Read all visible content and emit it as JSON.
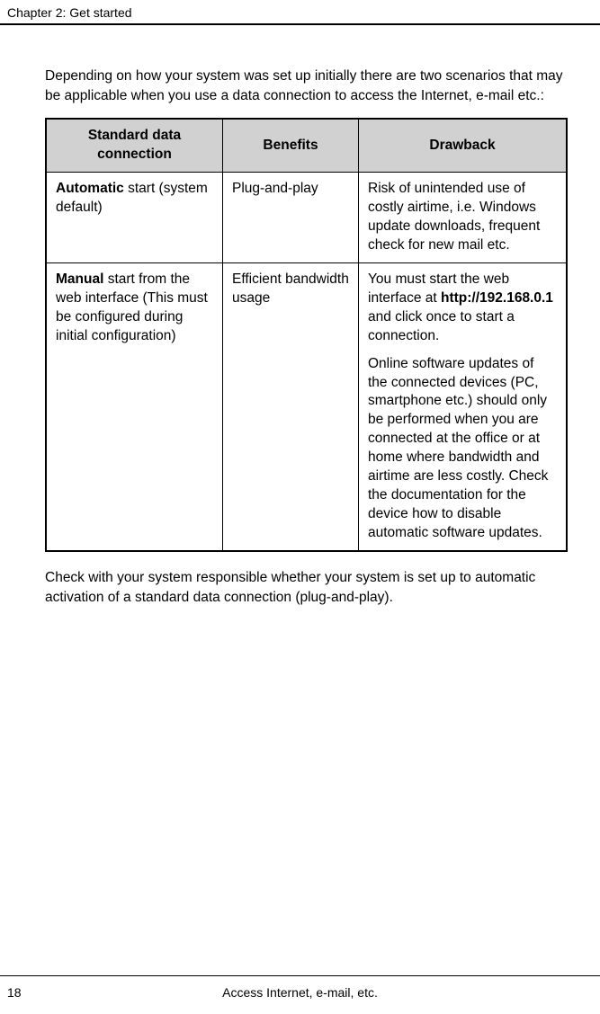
{
  "header": {
    "chapter_label": "Chapter 2:  Get started"
  },
  "intro": "Depending on how your system was set up initially there are two scenarios that may be applicable when you use a data connection to access the Internet, e-mail etc.:",
  "table": {
    "headers": {
      "connection": "Standard data connection",
      "benefits": "Benefits",
      "drawback": "Drawback"
    },
    "rows": [
      {
        "conn_bold": "Automatic",
        "conn_rest": " start (system default)",
        "benefits": "Plug-and-play",
        "drawback_plain": "Risk of unintended use of costly airtime, i.e. Windows update downloads, frequent check for new mail etc."
      },
      {
        "conn_bold": "Manual",
        "conn_rest": " start from the web interface (This must be configured during initial configuration)",
        "benefits": "Efficient bandwidth usage",
        "drawback_p1_pre": "You must start the web interface at ",
        "drawback_p1_bold": "http://192.168.0.1",
        "drawback_p1_post": " and click once to start a connection.",
        "drawback_p2": "Online software updates of the connected devices (PC, smartphone etc.) should only be performed when you are connected at the office or at home where bandwidth and airtime are less costly. Check the documentation for the device how to disable automatic software updates."
      }
    ]
  },
  "outro": "Check with your system responsible whether your system is set up to automatic activation of a standard data connection (plug-and-play).",
  "footer": {
    "page_number": "18",
    "title": "Access Internet, e-mail, etc."
  }
}
